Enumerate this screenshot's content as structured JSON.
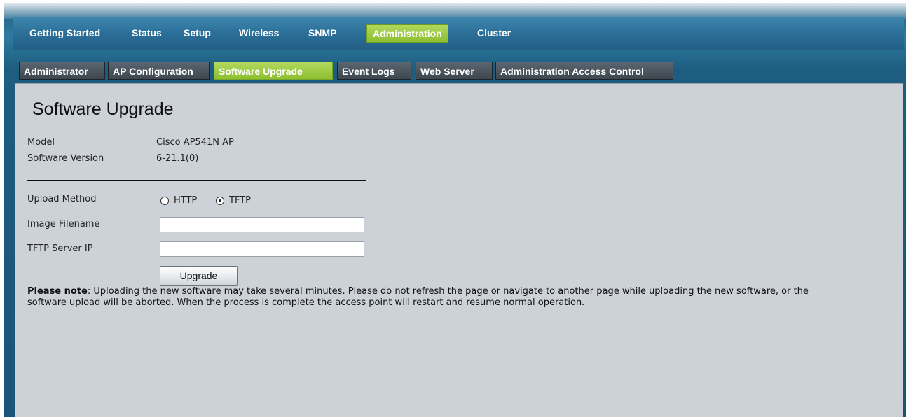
{
  "nav": {
    "items": [
      {
        "label": "Getting Started",
        "active": false
      },
      {
        "label": "Status",
        "active": false
      },
      {
        "label": "Setup",
        "active": false
      },
      {
        "label": "Wireless",
        "active": false
      },
      {
        "label": "SNMP",
        "active": false
      },
      {
        "label": "Administration",
        "active": true
      },
      {
        "label": "Cluster",
        "active": false
      }
    ]
  },
  "tabs": [
    {
      "label": "Administrator",
      "active": false
    },
    {
      "label": "AP Configuration",
      "active": false
    },
    {
      "label": "Software Upgrade",
      "active": true
    },
    {
      "label": "Event Logs",
      "active": false
    },
    {
      "label": "Web Server",
      "active": false
    },
    {
      "label": "Administration Access Control",
      "active": false
    }
  ],
  "page": {
    "title": "Software Upgrade",
    "model_label": "Model",
    "model_value": "Cisco AP541N AP",
    "version_label": "Software Version",
    "version_value": "6-21.1(0)",
    "upload_method_label": "Upload Method",
    "upload_options": [
      {
        "label": "HTTP",
        "checked": false
      },
      {
        "label": "TFTP",
        "checked": true
      }
    ],
    "image_filename_label": "Image Filename",
    "image_filename_value": "",
    "tftp_server_label": "TFTP Server IP",
    "tftp_server_value": "",
    "upgrade_button": "Upgrade",
    "note_bold": "Please note",
    "note_text": ": Uploading the new software may take several minutes. Please do not refresh the page or navigate to another page while uploading the new software, or the software upload will be aborted. When the process is complete the access point will restart and resume normal operation."
  },
  "colors": {
    "accent_green": "#8dbf2f",
    "nav_blue": "#2b6f98",
    "content_bg": "#cdd2d9"
  }
}
